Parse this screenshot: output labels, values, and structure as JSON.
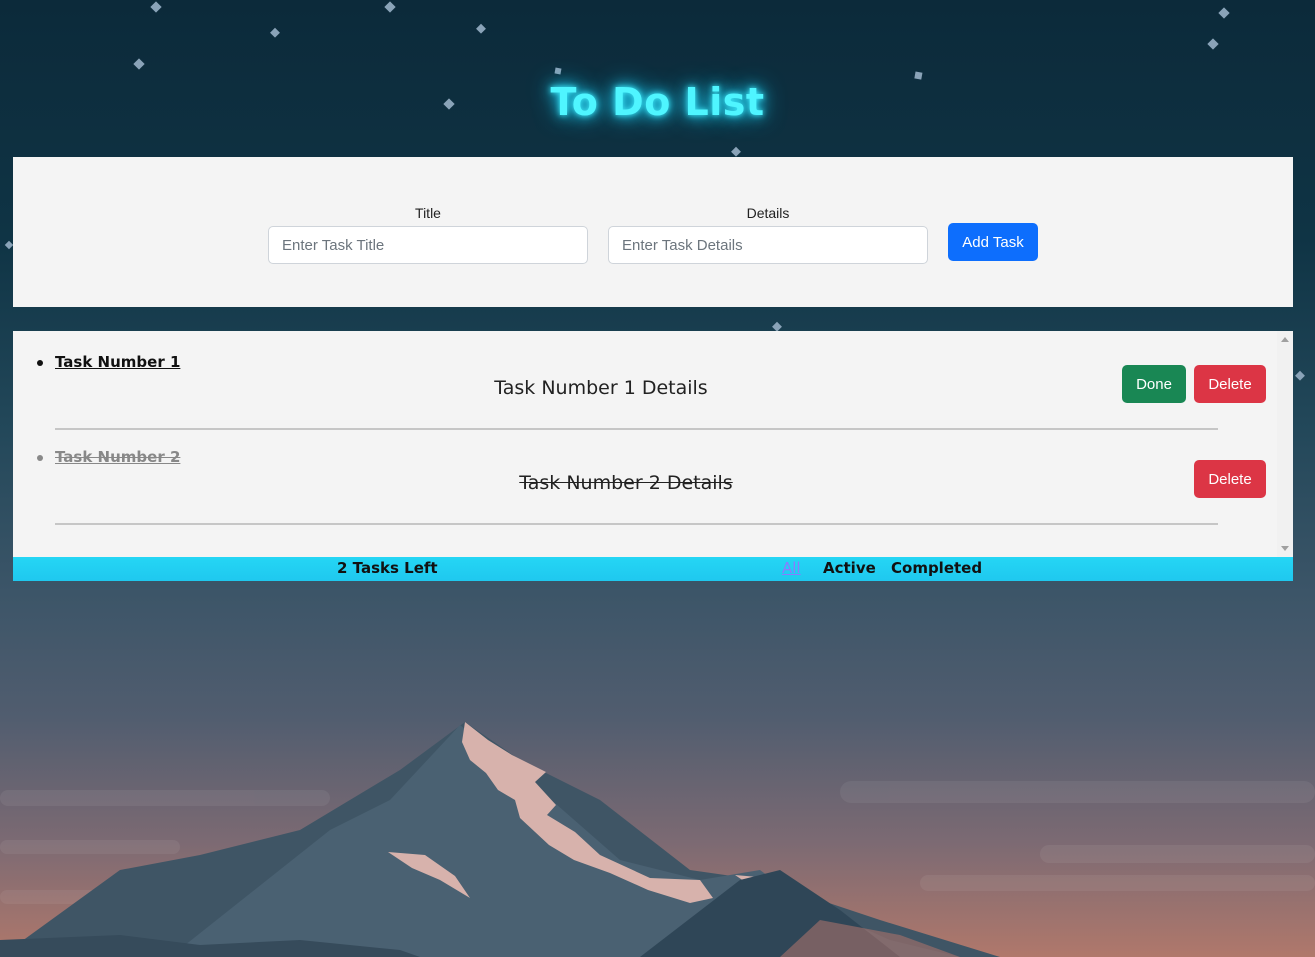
{
  "app": {
    "title": "To Do List"
  },
  "form": {
    "title_label": "Title",
    "title_placeholder": "Enter Task Title",
    "title_value": "",
    "details_label": "Details",
    "details_placeholder": "Enter Task Details",
    "details_value": "",
    "add_label": "Add Task"
  },
  "tasks": [
    {
      "title": "Task Number 1",
      "details": "Task Number 1 Details",
      "completed": false,
      "done_label": "Done",
      "delete_label": "Delete"
    },
    {
      "title": "Task Number 2",
      "details": "Task Number 2 Details",
      "completed": true,
      "delete_label": "Delete"
    }
  ],
  "footer": {
    "tasks_left": "2 Tasks Left",
    "filters": [
      "All",
      "Active",
      "Completed"
    ],
    "active_filter": "All"
  },
  "colors": {
    "title_glow": "#4ff5ff",
    "primary": "#0d6efd",
    "success": "#198754",
    "danger": "#dc3545",
    "footer": "#25d6f5",
    "active_filter": "#8a7bff"
  }
}
